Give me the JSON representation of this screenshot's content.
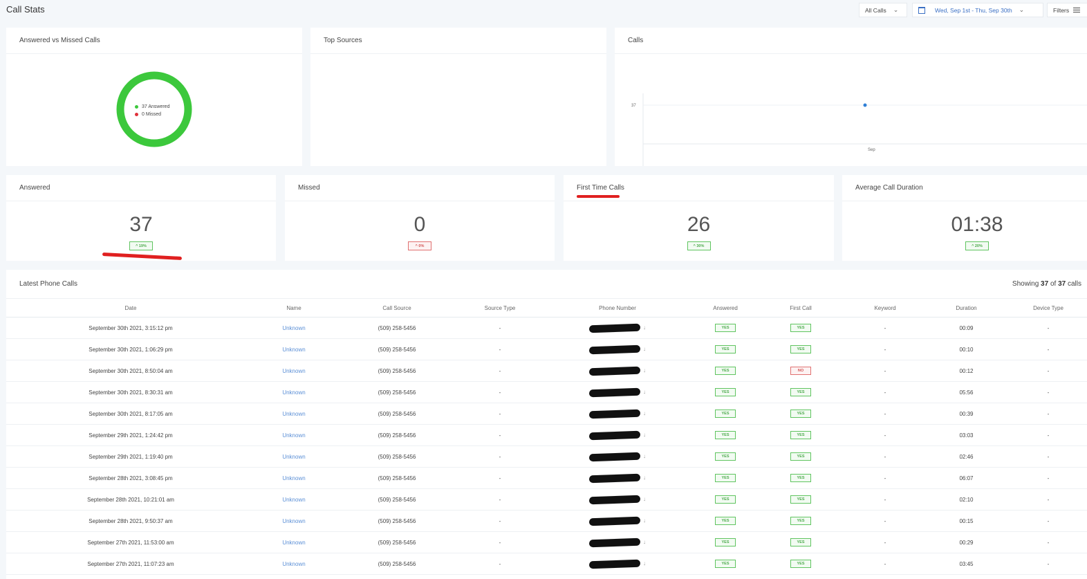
{
  "page": {
    "title": "Call Stats"
  },
  "toolbar": {
    "all_calls": "All Calls",
    "date_range": "Wed, Sep 1st - Thu, Sep 30th",
    "filters": "Filters"
  },
  "cards": {
    "answered_vs_missed": {
      "title": "Answered vs Missed Calls",
      "legend": [
        {
          "label": "37 Answered",
          "color": "#3cc83c"
        },
        {
          "label": "0 Missed",
          "color": "#e0303a"
        }
      ]
    },
    "top_sources": {
      "title": "Top Sources"
    },
    "calls": {
      "title": "Calls"
    }
  },
  "chart_data": {
    "type": "scatter",
    "title": "Calls",
    "x": [
      "Sep"
    ],
    "values": [
      37
    ],
    "yticks": [
      "37"
    ],
    "xticks": [
      "Sep"
    ]
  },
  "stats": [
    {
      "title": "Answered",
      "value": "37",
      "change": "^ 19%",
      "direction": "up"
    },
    {
      "title": "Missed",
      "value": "0",
      "change": "^ 0%",
      "direction": "down"
    },
    {
      "title": "First Time Calls",
      "value": "26",
      "change": "^ 30%",
      "direction": "up"
    },
    {
      "title": "Average Call Duration",
      "value": "01:38",
      "change": "^ 20%",
      "direction": "up"
    }
  ],
  "table": {
    "title": "Latest Phone Calls",
    "showing_prefix": "Showing",
    "showing_count": "37",
    "showing_of": "of",
    "showing_total": "37",
    "showing_suffix": "calls",
    "columns": [
      "Date",
      "Name",
      "Call Source",
      "Source Type",
      "Phone Number",
      "Answered",
      "First Call",
      "Keyword",
      "Duration",
      "Device Type"
    ],
    "rows": [
      {
        "date": "September 30th 2021, 3:15:12 pm",
        "name": "Unknown",
        "source": "(509) 258-5456",
        "source_type": "-",
        "answered": "YES",
        "first_call": "YES",
        "keyword": "-",
        "duration": "00:09",
        "device": "-"
      },
      {
        "date": "September 30th 2021, 1:06:29 pm",
        "name": "Unknown",
        "source": "(509) 258-5456",
        "source_type": "-",
        "answered": "YES",
        "first_call": "YES",
        "keyword": "-",
        "duration": "00:10",
        "device": "-"
      },
      {
        "date": "September 30th 2021, 8:50:04 am",
        "name": "Unknown",
        "source": "(509) 258-5456",
        "source_type": "-",
        "answered": "YES",
        "first_call": "NO",
        "keyword": "-",
        "duration": "00:12",
        "device": "-"
      },
      {
        "date": "September 30th 2021, 8:30:31 am",
        "name": "Unknown",
        "source": "(509) 258-5456",
        "source_type": "-",
        "answered": "YES",
        "first_call": "YES",
        "keyword": "-",
        "duration": "05:56",
        "device": "-"
      },
      {
        "date": "September 30th 2021, 8:17:05 am",
        "name": "Unknown",
        "source": "(509) 258-5456",
        "source_type": "-",
        "answered": "YES",
        "first_call": "YES",
        "keyword": "-",
        "duration": "00:39",
        "device": "-"
      },
      {
        "date": "September 29th 2021, 1:24:42 pm",
        "name": "Unknown",
        "source": "(509) 258-5456",
        "source_type": "-",
        "answered": "YES",
        "first_call": "YES",
        "keyword": "-",
        "duration": "03:03",
        "device": "-"
      },
      {
        "date": "September 29th 2021, 1:19:40 pm",
        "name": "Unknown",
        "source": "(509) 258-5456",
        "source_type": "-",
        "answered": "YES",
        "first_call": "YES",
        "keyword": "-",
        "duration": "02:46",
        "device": "-"
      },
      {
        "date": "September 28th 2021, 3:08:45 pm",
        "name": "Unknown",
        "source": "(509) 258-5456",
        "source_type": "-",
        "answered": "YES",
        "first_call": "YES",
        "keyword": "-",
        "duration": "06:07",
        "device": "-"
      },
      {
        "date": "September 28th 2021, 10:21:01 am",
        "name": "Unknown",
        "source": "(509) 258-5456",
        "source_type": "-",
        "answered": "YES",
        "first_call": "YES",
        "keyword": "-",
        "duration": "02:10",
        "device": "-"
      },
      {
        "date": "September 28th 2021, 9:50:37 am",
        "name": "Unknown",
        "source": "(509) 258-5456",
        "source_type": "-",
        "answered": "YES",
        "first_call": "YES",
        "keyword": "-",
        "duration": "00:15",
        "device": "-"
      },
      {
        "date": "September 27th 2021, 11:53:00 am",
        "name": "Unknown",
        "source": "(509) 258-5456",
        "source_type": "-",
        "answered": "YES",
        "first_call": "YES",
        "keyword": "-",
        "duration": "00:29",
        "device": "-"
      },
      {
        "date": "September 27th 2021, 11:07:23 am",
        "name": "Unknown",
        "source": "(509) 258-5456",
        "source_type": "-",
        "answered": "YES",
        "first_call": "YES",
        "keyword": "-",
        "duration": "03:45",
        "device": "-"
      }
    ]
  },
  "colors": {
    "answered": "#3cc83c",
    "missed": "#e0303a",
    "link": "#5b8fd6",
    "annotation": "#e02020"
  }
}
